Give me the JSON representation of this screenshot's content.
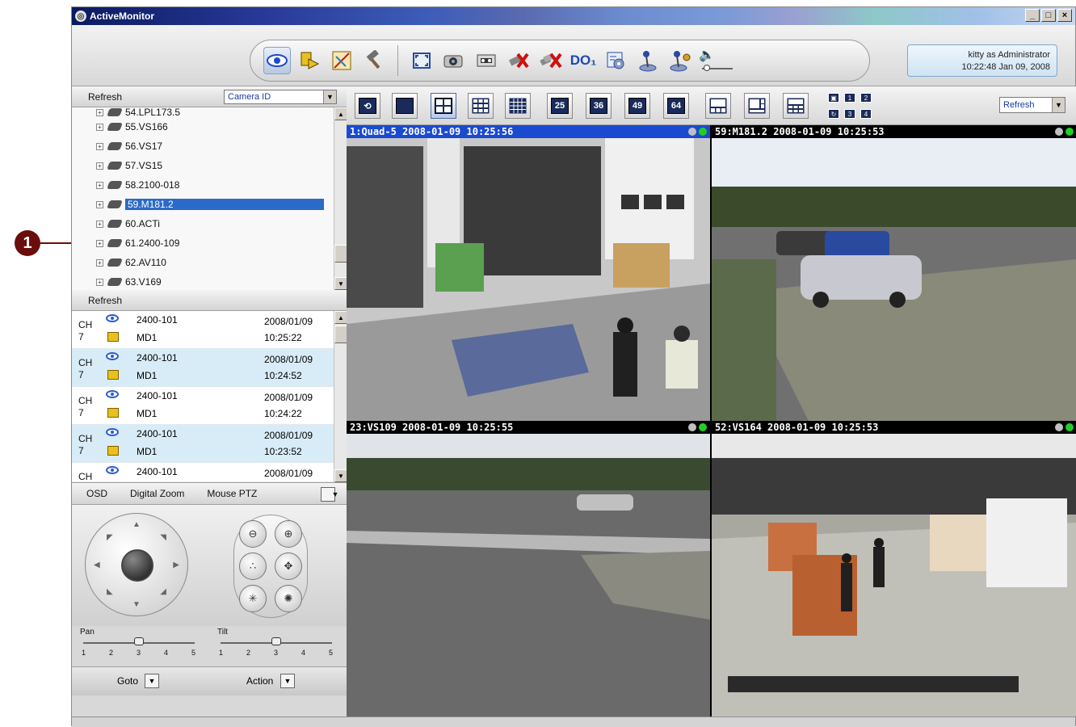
{
  "callout": {
    "number": "1"
  },
  "window": {
    "title": "ActiveMonitor",
    "controls": [
      "_",
      "□",
      "×"
    ]
  },
  "toolbar": {
    "icons": [
      "live-view-icon",
      "event-icon",
      "map-icon",
      "tools-icon",
      "fullscreen-icon",
      "snapshot-icon",
      "record-icon",
      "disconnect-icon",
      "disconnect-all-icon",
      "do1-label",
      "settings-icon",
      "joystick-icon",
      "joystick-settings-icon",
      "volume-icon"
    ],
    "do_label": "DO₁"
  },
  "user": {
    "line1": "kitty as Administrator",
    "line2": "10:22:48 Jan 09, 2008"
  },
  "camera_tree": {
    "refresh": "Refresh",
    "sort_by": "Camera ID",
    "items": [
      {
        "label": "54.LPL173.5"
      },
      {
        "label": "55.VS166"
      },
      {
        "label": "56.VS17"
      },
      {
        "label": "57.VS15"
      },
      {
        "label": "58.2100-018"
      },
      {
        "label": "59.M181.2",
        "selected": true
      },
      {
        "label": "60.ACTi"
      },
      {
        "label": "61.2400-109"
      },
      {
        "label": "62.AV110"
      },
      {
        "label": "63.V169"
      }
    ]
  },
  "event_list": {
    "refresh": "Refresh",
    "events": [
      {
        "ch": "CH",
        "num": "7",
        "source": "2400-101",
        "type": "MD1",
        "date": "2008/01/09",
        "time": "10:25:22"
      },
      {
        "ch": "CH",
        "num": "7",
        "source": "2400-101",
        "type": "MD1",
        "date": "2008/01/09",
        "time": "10:24:52"
      },
      {
        "ch": "CH",
        "num": "7",
        "source": "2400-101",
        "type": "MD1",
        "date": "2008/01/09",
        "time": "10:24:22"
      },
      {
        "ch": "CH",
        "num": "7",
        "source": "2400-101",
        "type": "MD1",
        "date": "2008/01/09",
        "time": "10:23:52"
      },
      {
        "ch": "CH",
        "num": "",
        "source": "2400-101",
        "type": "",
        "date": "2008/01/09",
        "time": ""
      }
    ]
  },
  "ptz": {
    "tabs": [
      "OSD",
      "Digital Zoom",
      "Mouse PTZ"
    ],
    "pan_label": "Pan",
    "tilt_label": "Tilt",
    "pan_value": 3,
    "tilt_value": 3,
    "ticks": [
      "1",
      "2",
      "3",
      "4",
      "5"
    ],
    "goto_label": "Goto",
    "action_label": "Action"
  },
  "layouts": {
    "buttons": [
      "sequence",
      "1",
      "4",
      "9",
      "16",
      "25",
      "36",
      "49",
      "64",
      "layout-a",
      "layout-b",
      "layout-c"
    ],
    "active_index": 2,
    "labels": {
      "b25": "25",
      "b36": "36",
      "b49": "49",
      "b64": "64"
    },
    "page_buttons": [
      "▣",
      "1",
      "2",
      "↻",
      "3",
      "4"
    ],
    "refresh": "Refresh"
  },
  "videos": [
    {
      "header": "1:Quad-5   2008-01-09 10:25:56",
      "active": true,
      "scene": "warehouse-doors"
    },
    {
      "header": "59:M181.2   2008-01-09 10:25:53",
      "active": false,
      "scene": "parking-lot"
    },
    {
      "header": "23:VS109   2008-01-09 10:25:55",
      "active": false,
      "scene": "road"
    },
    {
      "header": "52:VS164   2008-01-09 10:25:53",
      "active": false,
      "scene": "warehouse-interior"
    }
  ],
  "colors": {
    "accent": "#1a4ad0",
    "callout": "#6b0d0d",
    "selected_row": "#2a6ac8",
    "event_alt_row": "#d8ecf8"
  }
}
